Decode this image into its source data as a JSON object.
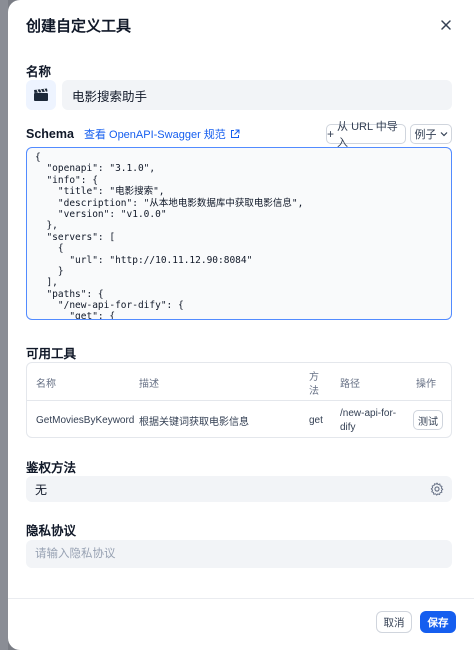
{
  "dialog": {
    "title": "创建自定义工具"
  },
  "name": {
    "label": "名称",
    "value": "电影搜索助手",
    "icon": "clapperboard-icon"
  },
  "schema": {
    "label": "Schema",
    "link_label": "查看 OpenAPI-Swagger 规范",
    "import_label": "从 URL 中导入",
    "example_label": "例子",
    "code_lines": [
      "{",
      "  \"openapi\": \"3.1.0\",",
      "  \"info\": {",
      "    \"title\": \"电影搜索\",",
      "    \"description\": \"从本地电影数据库中获取电影信息\",",
      "    \"version\": \"v1.0.0\"",
      "  },",
      "  \"servers\": [",
      "    {",
      "      \"url\": \"http://10.11.12.90:8084\"",
      "    }",
      "  ],",
      "  \"paths\": {",
      "    \"/new-api-for-dify\": {",
      "      \"get\": {"
    ]
  },
  "tools": {
    "label": "可用工具",
    "headers": {
      "name": "名称",
      "desc": "描述",
      "method_1": "方",
      "method_2": "法",
      "path": "路径",
      "action": "操作"
    },
    "rows": [
      {
        "name": "GetMoviesByKeyword",
        "desc": "根据关键词获取电影信息",
        "method": "get",
        "path_1": "/new-api-for-",
        "path_2": "dify",
        "action": "测试"
      }
    ]
  },
  "auth": {
    "label": "鉴权方法",
    "value": "无"
  },
  "privacy": {
    "label": "隐私协议",
    "placeholder": "请输入隐私协议",
    "value": ""
  },
  "footer": {
    "cancel_label": "取消",
    "save_label": "保存"
  },
  "colors": {
    "accent": "#155eef",
    "focus_border": "#528bff",
    "field_bg": "#f2f4f7"
  }
}
